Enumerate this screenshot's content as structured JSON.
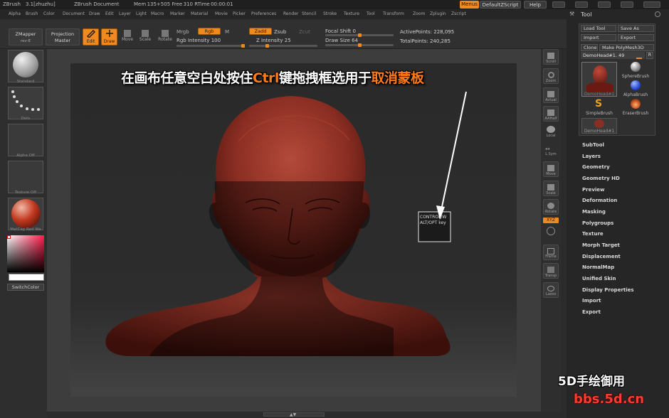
{
  "titlebar": {
    "app": "ZBrush",
    "version": "3.1[zhuzhu]",
    "document": "ZBrush Document",
    "mem": "Mem 135+505 Free 310 RTime 00:00:01",
    "menus_btn": "Menus",
    "script_btn": "DefaultZScript",
    "help_btn": "Help"
  },
  "menubar": [
    "Alpha",
    "Brush",
    "Color",
    "Document",
    "Draw",
    "Edit",
    "Layer",
    "Light",
    "Macro",
    "Marker",
    "Material",
    "Movie",
    "Picker",
    "Preferences",
    "Render",
    "Stencil",
    "Stroke",
    "Texture",
    "Tool",
    "Transform",
    "Zoom",
    "Zplugin",
    "Zscript"
  ],
  "shelf": {
    "zmapper": "ZMapper",
    "zmapper_sub": "rev-E",
    "projection": "Projection",
    "projection_sub": "Master",
    "edit": "Edit",
    "draw": "Draw",
    "move": "Move",
    "scale": "Scale",
    "rotate": "Rotate",
    "mrgb": "Mrgb",
    "rgb": "Rgb",
    "m": "M",
    "rgb_intensity_label": "Rgb Intensity",
    "rgb_intensity_value": "100",
    "zadd": "Zadd",
    "zsub": "Zsub",
    "zcut": "Zcut",
    "z_intensity_label": "Z Intensity",
    "z_intensity_value": "25",
    "focal_shift_label": "Focal Shift",
    "focal_shift_value": "0",
    "draw_size_label": "Draw Size",
    "draw_size_value": "64",
    "active_points": "ActivePoints: 228,095",
    "total_points": "TotalPoints: 240,285"
  },
  "lefttray": {
    "standard": "Standard",
    "dots": "Dots",
    "alpha": "Alpha Off",
    "texture": "Texture Off",
    "material": "MatCap Red Wa",
    "switch_color": "SwitchColor"
  },
  "rightstrip": [
    "Scroll",
    "Zoom",
    "Actual",
    "AAHalf",
    "Local",
    "L.Sym",
    "Move",
    "Scale",
    "Rotate",
    "XYZ",
    "Frame",
    "Transp",
    "Lasso"
  ],
  "toolpanel": {
    "title": "Tool",
    "load": "Load Tool",
    "save": "Save As",
    "import": "Import",
    "export": "Export",
    "clone": "Clone",
    "make_polymesh": "Make PolyMesh3D",
    "current_tool": "DemoHead#1. 49",
    "r_btn": "R",
    "brushes": [
      "DemoHead#1",
      "SphereBrush",
      "AlphaBrush",
      "SimpleBrush",
      "EraserBrush",
      "DemoHead#1"
    ],
    "items": [
      "SubTool",
      "Layers",
      "Geometry",
      "Geometry HD",
      "Preview",
      "Deformation",
      "Masking",
      "Polygroups",
      "Texture",
      "Morph Target",
      "Displacement",
      "NormalMap",
      "Unified Skin",
      "Display Properties",
      "Import",
      "Export"
    ]
  },
  "annotation": {
    "part1": "在画布任意空白处按住",
    "key": "Ctrl",
    "part2": "键拖拽框选用于",
    "highlight": "取消蒙板"
  },
  "tooltip": {
    "line1": "CONTROL/W",
    "line2": "ALT/OPT key"
  },
  "watermark": {
    "line1": "5D手绘御用",
    "line2": "bbs.5d.cn"
  },
  "colors": {
    "accent": "#f08a1e",
    "head": "#8a2d22",
    "annotation_highlight": "#ff7a1a",
    "watermark_red": "#ff3b2f"
  }
}
